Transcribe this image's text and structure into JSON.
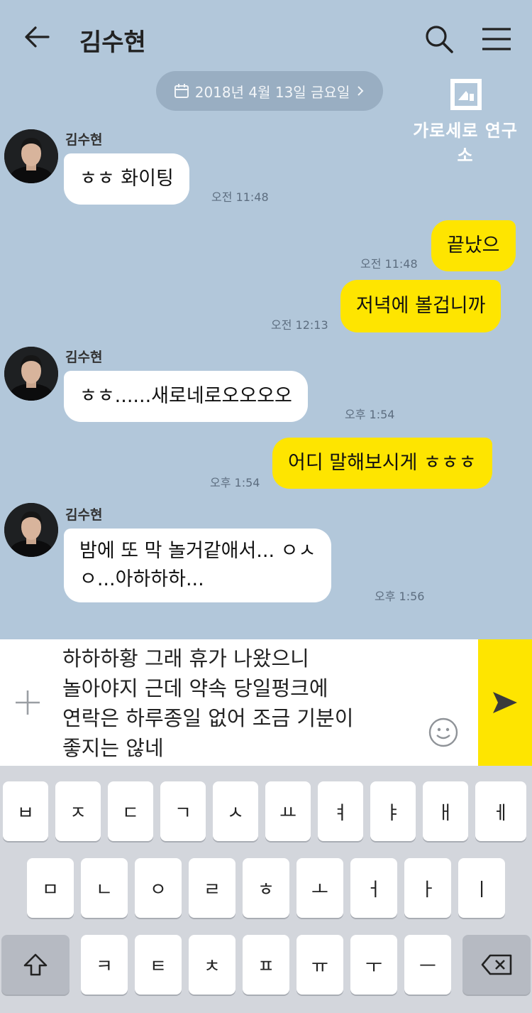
{
  "header": {
    "back_icon": "arrow-left-icon",
    "title": "김수현",
    "search_icon": "search-icon",
    "menu_icon": "hamburger-menu-icon"
  },
  "date_divider": {
    "label": "2018년 4월 13일 금요일",
    "calendar_icon": "calendar-icon",
    "chevron_icon": "chevron-right-icon"
  },
  "watermark": {
    "text": "가로세로 연구소"
  },
  "messages": [
    {
      "side": "in",
      "sender": "김수현",
      "text": "ㅎㅎ 화이팅",
      "time": "오전 11:48"
    },
    {
      "side": "out",
      "text": "끝났으",
      "time": "오전 11:48"
    },
    {
      "side": "out",
      "text": "저녁에 볼겁니까",
      "time": "오전 12:13"
    },
    {
      "side": "in",
      "sender": "김수현",
      "text": "ㅎㅎ......새로네로오오오오",
      "time": "오후 1:54"
    },
    {
      "side": "out",
      "text": "어디 말해보시게 ㅎㅎㅎ",
      "time": "오후 1:54"
    },
    {
      "side": "in",
      "sender": "김수현",
      "text_line1": "밤에 또 막 놀거같애서... ㅇㅅ",
      "text_line2": "ㅇ...아하하하...",
      "time": "오후 1:56"
    }
  ],
  "composer": {
    "plus_icon": "plus-icon",
    "lines": [
      "하하하황 그래 휴가 나왔으니",
      "놀아야지 근데 약속 당일펑크에",
      "연락은 하루종일 없어 조금 기분이",
      "좋지는 않네"
    ],
    "emoji_icon": "smiley-icon",
    "send_icon": "send-icon"
  },
  "keyboard": {
    "row1": [
      "ㅂ",
      "ㅈ",
      "ㄷ",
      "ㄱ",
      "ㅅ",
      "ㅛ",
      "ㅕ",
      "ㅑ",
      "ㅐ",
      "ㅔ"
    ],
    "row2": [
      "ㅁ",
      "ㄴ",
      "ㅇ",
      "ㄹ",
      "ㅎ",
      "ㅗ",
      "ㅓ",
      "ㅏ",
      "ㅣ"
    ],
    "row3": [
      "ㅋ",
      "ㅌ",
      "ㅊ",
      "ㅍ",
      "ㅠ",
      "ㅜ",
      "ㅡ"
    ],
    "shift_icon": "shift-icon",
    "backspace_icon": "backspace-icon"
  }
}
